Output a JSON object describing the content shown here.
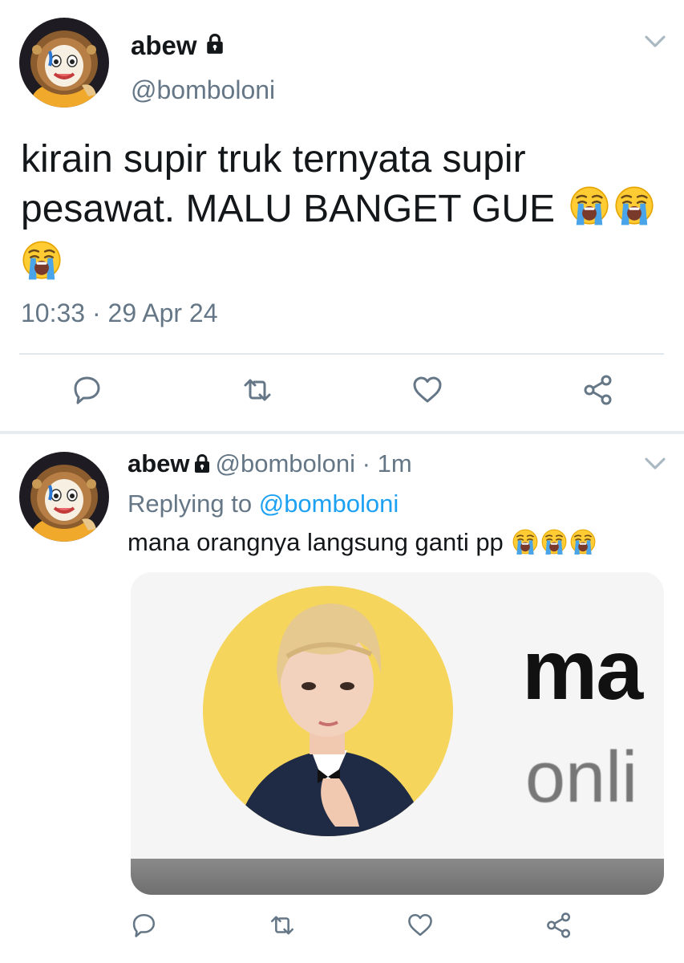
{
  "main_tweet": {
    "display_name": "abew",
    "handle": "@bomboloni",
    "text": "kirain supir truk ternyata supir pesawat. MALU BANGET GUE",
    "emojis": [
      "loudly-crying-face-emoji",
      "loudly-crying-face-emoji",
      "loudly-crying-face-emoji"
    ],
    "timestamp": "10:33 · 29 Apr 24",
    "actions": [
      "reply-icon",
      "retweet-icon",
      "like-icon",
      "share-icon"
    ]
  },
  "reply_tweet": {
    "display_name": "abew",
    "handle": "@bomboloni",
    "separator": "·",
    "time": "1m",
    "replying_prefix": "Replying to",
    "replying_to": "@bomboloni",
    "text": "mana orangnya langsung ganti pp",
    "emojis": [
      "loudly-crying-face-emoji",
      "loudly-crying-face-emoji",
      "loudly-crying-face-emoji"
    ],
    "media": {
      "big_text": "ma",
      "small_text": "onli"
    },
    "actions": [
      "reply-icon",
      "retweet-icon",
      "like-icon",
      "share-icon"
    ]
  },
  "colors": {
    "text": "#14171a",
    "secondary": "#657786",
    "link": "#1da1f2",
    "icon": "#657786",
    "divider": "#e1e8ed"
  }
}
